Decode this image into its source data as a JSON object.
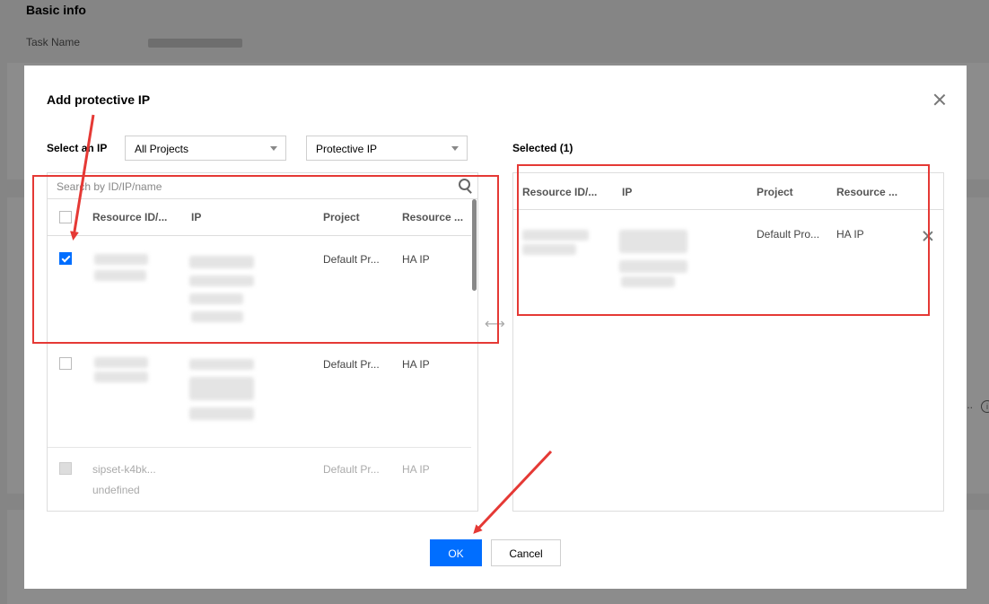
{
  "background": {
    "section_title": "Basic info",
    "task_name_label": "Task Name"
  },
  "modal": {
    "title": "Add protective IP",
    "select_label": "Select an IP",
    "project_select": "All Projects",
    "type_select": "Protective IP",
    "search_placeholder": "Search by ID/IP/name",
    "columns": [
      "Resource ID/...",
      "IP",
      "Project",
      "Resource ..."
    ],
    "rows": [
      {
        "checked": true,
        "disabled": false,
        "resource_id": "",
        "ip": "",
        "project": "Default Pr...",
        "resource": "HA IP"
      },
      {
        "checked": false,
        "disabled": false,
        "resource_id": "",
        "ip": "",
        "project": "Default Pr...",
        "resource": "HA IP"
      },
      {
        "checked": false,
        "disabled": true,
        "resource_id": "sipset-k4bk...",
        "ip": "undefined",
        "project": "Default Pr...",
        "resource": "HA IP"
      }
    ],
    "selected_label": "Selected (1)",
    "selected_columns": [
      "Resource ID/...",
      "IP",
      "Project",
      "Resource ..."
    ],
    "selected_rows": [
      {
        "resource_id": "",
        "ip": "",
        "project": "Default Pro...",
        "resource": "HA IP"
      }
    ],
    "ok_label": "OK",
    "cancel_label": "Cancel"
  },
  "colors": {
    "primary": "#006eff",
    "annotation": "#e53935"
  }
}
